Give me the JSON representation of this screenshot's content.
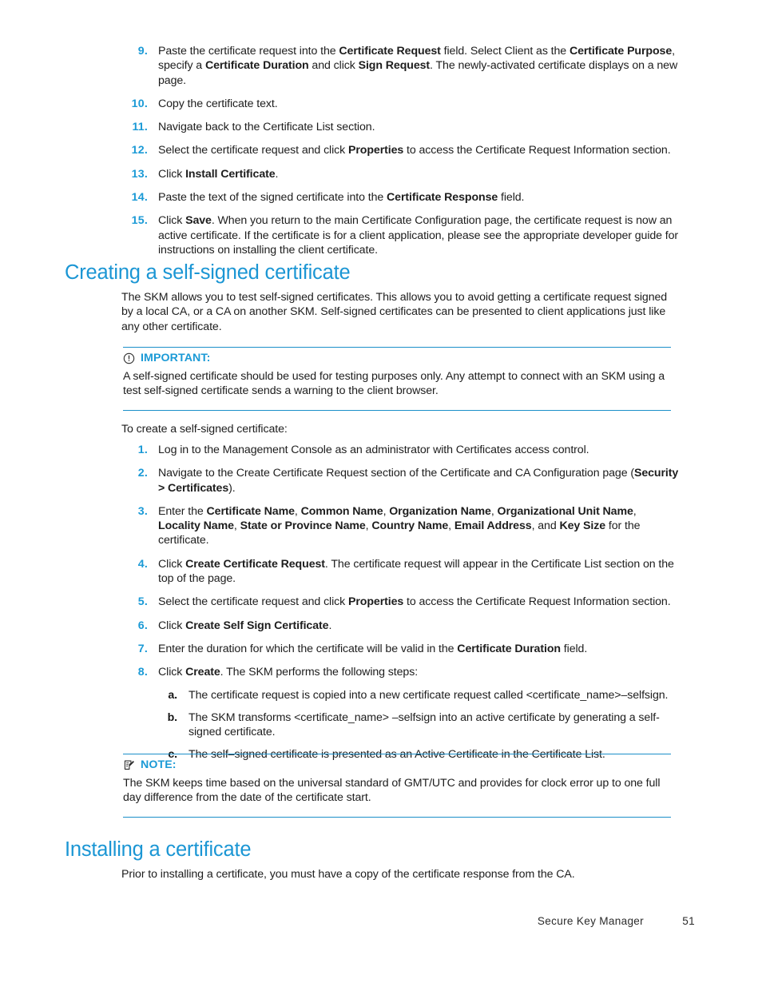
{
  "document": {
    "footer": {
      "title": "Secure Key Manager",
      "page_number": "51"
    },
    "colors": {
      "heading_blue": "#1b96d4",
      "marker_blue": "#1b9ad6",
      "rule_blue": "#1b8fc9",
      "body_black": "#1d1d1d"
    }
  },
  "continued_list": {
    "items": [
      {
        "marker": "9.",
        "segments": [
          {
            "t": "Paste the certificate request into the ",
            "b": false
          },
          {
            "t": "Certificate Request",
            "b": true
          },
          {
            "t": " field.  Select Client as the ",
            "b": false
          },
          {
            "t": "Certificate Purpose",
            "b": true
          },
          {
            "t": ", specify a ",
            "b": false
          },
          {
            "t": "Certificate Duration",
            "b": true
          },
          {
            "t": " and click ",
            "b": false
          },
          {
            "t": "Sign Request",
            "b": true
          },
          {
            "t": ".  The newly-activated certificate displays on a new page.",
            "b": false
          }
        ]
      },
      {
        "marker": "10.",
        "segments": [
          {
            "t": "Copy the certificate text.",
            "b": false
          }
        ]
      },
      {
        "marker": "11.",
        "segments": [
          {
            "t": "Navigate back to the Certificate List section.",
            "b": false
          }
        ]
      },
      {
        "marker": "12.",
        "segments": [
          {
            "t": "Select the certificate request and click ",
            "b": false
          },
          {
            "t": "Properties",
            "b": true
          },
          {
            "t": " to access the Certificate Request Information section.",
            "b": false
          }
        ]
      },
      {
        "marker": "13.",
        "segments": [
          {
            "t": "Click ",
            "b": false
          },
          {
            "t": "Install Certificate",
            "b": true
          },
          {
            "t": ".",
            "b": false
          }
        ]
      },
      {
        "marker": "14.",
        "segments": [
          {
            "t": "Paste the text of the signed certificate into the ",
            "b": false
          },
          {
            "t": "Certificate Response",
            "b": true
          },
          {
            "t": " field.",
            "b": false
          }
        ]
      },
      {
        "marker": "15.",
        "segments": [
          {
            "t": "Click ",
            "b": false
          },
          {
            "t": "Save",
            "b": true
          },
          {
            "t": ".  When you return to the main Certificate Configuration page, the certificate request is now an active certificate.  If the certificate is for a client application, please see the appropriate developer guide for instructions on installing the client certificate.",
            "b": false
          }
        ]
      }
    ]
  },
  "section_self_signed": {
    "heading": "Creating a self-signed certificate",
    "intro": "The SKM allows you to test self-signed certificates.  This allows you to avoid getting a certificate request signed by a local CA, or a CA on another SKM. Self-signed certificates can be presented to client applications just like any other certificate.",
    "important": {
      "icon": "exclamation-circle-icon",
      "label": "IMPORTANT:",
      "text": "A self-signed certificate should be used for testing purposes only.  Any attempt to connect with an SKM using a test self-signed certificate sends a warning to the client browser."
    },
    "lead_in": "To create a self-signed certificate:",
    "steps": [
      {
        "marker": "1.",
        "segments": [
          {
            "t": "Log in to the Management Console as an administrator with Certificates access control.",
            "b": false
          }
        ]
      },
      {
        "marker": "2.",
        "segments": [
          {
            "t": "Navigate to the Create Certificate Request section of the Certificate and CA Configuration page (",
            "b": false
          },
          {
            "t": "Security > Certificates",
            "b": true
          },
          {
            "t": ").",
            "b": false
          }
        ]
      },
      {
        "marker": "3.",
        "segments": [
          {
            "t": "Enter the ",
            "b": false
          },
          {
            "t": "Certificate Name",
            "b": true
          },
          {
            "t": ", ",
            "b": false
          },
          {
            "t": "Common Name",
            "b": true
          },
          {
            "t": ", ",
            "b": false
          },
          {
            "t": "Organization Name",
            "b": true
          },
          {
            "t": ", ",
            "b": false
          },
          {
            "t": "Organizational Unit Name",
            "b": true
          },
          {
            "t": ", ",
            "b": false
          },
          {
            "t": "Locality Name",
            "b": true
          },
          {
            "t": ", ",
            "b": false
          },
          {
            "t": "State or Province Name",
            "b": true
          },
          {
            "t": ", ",
            "b": false
          },
          {
            "t": "Country Name",
            "b": true
          },
          {
            "t": ", ",
            "b": false
          },
          {
            "t": "Email Address",
            "b": true
          },
          {
            "t": ", and ",
            "b": false
          },
          {
            "t": "Key Size",
            "b": true
          },
          {
            "t": " for the certificate.",
            "b": false
          }
        ]
      },
      {
        "marker": "4.",
        "segments": [
          {
            "t": "Click ",
            "b": false
          },
          {
            "t": "Create Certificate Request",
            "b": true
          },
          {
            "t": ".  The certificate request will appear in the Certificate List section on the top of the page.",
            "b": false
          }
        ]
      },
      {
        "marker": "5.",
        "segments": [
          {
            "t": "Select the certificate request and click ",
            "b": false
          },
          {
            "t": "Properties",
            "b": true
          },
          {
            "t": " to access the Certificate Request Information section.",
            "b": false
          }
        ]
      },
      {
        "marker": "6.",
        "segments": [
          {
            "t": "Click ",
            "b": false
          },
          {
            "t": "Create Self Sign Certificate",
            "b": true
          },
          {
            "t": ".",
            "b": false
          }
        ]
      },
      {
        "marker": "7.",
        "segments": [
          {
            "t": "Enter the duration for which the certificate will be valid in the ",
            "b": false
          },
          {
            "t": "Certificate Duration",
            "b": true
          },
          {
            "t": " field.",
            "b": false
          }
        ]
      },
      {
        "marker": "8.",
        "segments": [
          {
            "t": "Click ",
            "b": false
          },
          {
            "t": "Create",
            "b": true
          },
          {
            "t": ".  The SKM performs the following steps:",
            "b": false
          }
        ],
        "substeps": [
          {
            "marker": "a.",
            "segments": [
              {
                "t": "The certificate request is copied into a new certificate request called <certificate_name>–selfsign.",
                "b": false
              }
            ]
          },
          {
            "marker": "b.",
            "segments": [
              {
                "t": "The SKM transforms <certificate_name> –selfsign into an active certificate by generating a self-signed certificate.",
                "b": false
              }
            ]
          },
          {
            "marker": "c.",
            "segments": [
              {
                "t": "The self–signed certificate is presented as an Active Certificate in the Certificate List.",
                "b": false
              }
            ]
          }
        ]
      }
    ],
    "note": {
      "icon": "note-pencil-icon",
      "label": "NOTE:",
      "text": "The SKM keeps time based on the universal standard of GMT/UTC and provides for clock error up to one full day difference from the date of the certificate start."
    }
  },
  "section_installing": {
    "heading": "Installing a certificate",
    "intro": "Prior to installing a certificate, you must have a copy of the certificate response from the CA."
  }
}
